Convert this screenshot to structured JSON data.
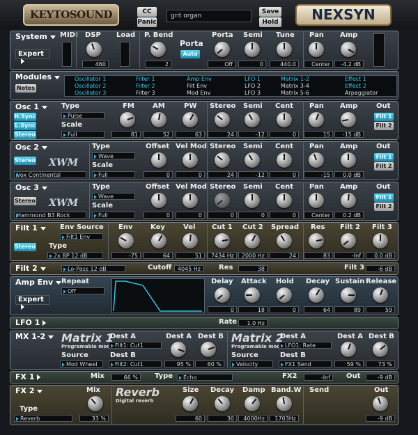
{
  "header": {
    "logo_left": "KEYTOSOUND",
    "logo_right": "NEXSYN",
    "cc": "CC",
    "panic": "Panic",
    "patch": "grit organ",
    "save": "Save",
    "hold": "Hold"
  },
  "system": {
    "title": "System",
    "expert": "Expert",
    "midi": "MIDI",
    "dsp": "DSP",
    "load": "Load",
    "pbend": "P. Bend",
    "porta_title": "Porta",
    "auto": "Auto",
    "porta": "Porta",
    "semi": "Semi",
    "tune": "Tune",
    "pan": "Pan",
    "amp": "Amp",
    "v_dsp": "460",
    "v_pbend": "2",
    "v_porta": "Off",
    "v_semi": "0",
    "v_tune": "440.0",
    "v_pan": "Center",
    "v_amp": "-4.2 dB"
  },
  "modules": {
    "title": "Modules",
    "notes": "Notes",
    "c1": [
      "Oscillator 1",
      "Oscillator 2",
      "Oscillator 3"
    ],
    "c2": [
      "Filter 1",
      "Filter 2",
      "Filter 3"
    ],
    "c3": [
      "Amp Env",
      "Filt Env",
      "Mod Env"
    ],
    "c4": [
      "LFO 1",
      "LFO 2",
      "LFO 3"
    ],
    "c5": [
      "Matrix 1-2",
      "Matrix 3-4",
      "Matrix 5-6"
    ],
    "c6": [
      "Effect 1",
      "Effect 2",
      "Arpeggiator"
    ]
  },
  "osc1": {
    "title": "Osc 1",
    "hsync": "H.Sync",
    "lsync": "L.Sync",
    "stereo": "Stereo",
    "type": "Type",
    "type_val": "Pulse",
    "scale": "Scale",
    "scale_val": "Full",
    "fm": "FM",
    "am": "AM",
    "pw": "PW",
    "st": "Stereo",
    "semi": "Semi",
    "cent": "Cent",
    "pan": "Pan",
    "amp": "Amp",
    "out": "Out",
    "f1": "Filt 1",
    "f2": "Filt 2",
    "v_fm": "81",
    "v_am": "52",
    "v_pw": "63",
    "v_st": "24",
    "v_semi": "-12",
    "v_cent": "0",
    "v_pan": "15",
    "v_amp": "-15 dB"
  },
  "osc2": {
    "title": "Osc 2",
    "stereo": "Stereo",
    "xwm": "XWM",
    "patch": "Vox Continental",
    "type": "Type",
    "type_val": "Wave",
    "scale": "Scale",
    "scale_val": "Full",
    "offset": "Offset",
    "velmod": "Vel Mod",
    "st": "Stereo",
    "semi": "Semi",
    "cent": "Cent",
    "pan": "Pan",
    "amp": "Amp",
    "out": "Out",
    "f1": "Filt 1",
    "f2": "Filt 2",
    "v_offset": "0",
    "v_velmod": "0",
    "v_st": "24",
    "v_semi": "-12",
    "v_cent": "0",
    "v_pan": "-15",
    "v_amp": "0.0 dB"
  },
  "osc3": {
    "title": "Osc 3",
    "stereo": "Stereo",
    "xwm": "XWM",
    "patch": "Hammond B3 Rock",
    "type": "Type",
    "type_val": "Wave",
    "scale": "Scale",
    "scale_val": "Full",
    "offset": "Offset",
    "velmod": "Vel Mod",
    "st": "Stereo",
    "semi": "Semi",
    "cent": "Cent",
    "pan": "Pan",
    "amp": "Amp",
    "out": "Out",
    "f1": "Filt 1",
    "f2": "Filt 2",
    "v_offset": "0",
    "v_velmod": "0",
    "v_st": "0",
    "v_semi": "0",
    "v_cent": "0",
    "v_pan": "Center",
    "v_amp": "0.2 dB"
  },
  "filt1": {
    "title": "Filt 1",
    "stereo": "Stereo",
    "envsrc": "Env Source",
    "envsrc_val": "Filt1 Env",
    "type": "Type",
    "type_val": "2x BP 12 dB",
    "env": "Env",
    "key": "Key",
    "vel": "Vel",
    "cut1": "Cut 1",
    "cut2": "Cut 2",
    "spread": "Spread",
    "res": "Res",
    "filt2": "Filt 2",
    "filt3": "Filt 3",
    "v_env": "-75",
    "v_key": "64",
    "v_vel": "51",
    "v_cut1": "7434 Hz",
    "v_cut2": "2000 Hz",
    "v_spread": "24",
    "v_res": "83",
    "v_filt2": "-Inf",
    "v_filt3": "0.0 dB"
  },
  "filt2": {
    "title": "Filt 2",
    "type_val": "Lo-Pass 12 dB",
    "cutoff": "Cutoff",
    "v_cutoff": "4045 Hz",
    "res": "Res",
    "v_res": "38",
    "filt3": "Filt 3",
    "v_filt3": "-6 dB"
  },
  "ampenv": {
    "title": "Amp Env",
    "repeat": "Repeat",
    "repeat_val": "Off",
    "expert": "Expert",
    "delay": "Delay",
    "attack": "Attack",
    "hold": "Hold",
    "decay": "Decay",
    "sustain": "Sustain",
    "release": "Release",
    "v_delay": "0",
    "v_attack": "18",
    "v_hold": "0",
    "v_decay": "64",
    "v_sustain": "89",
    "v_release": "59"
  },
  "lfo1": {
    "title": "LFO 1",
    "rate": "Rate",
    "v_rate": "1.0 Hz"
  },
  "mx": {
    "title": "MX 1-2",
    "m1": "Matrix 1",
    "m2": "Matrix 2",
    "sub": "Programable mod.",
    "source": "Source",
    "desta": "Dest A",
    "destb": "Dest B",
    "m1_source": "Mod Wheel",
    "m1_desta": "Filt1: Cut1",
    "m1_destb": "Filt2: Cut1",
    "m1_a": "95 %",
    "m1_b": "60 %",
    "m2_source": "Velocity",
    "m2_desta": "LFO1: Rate",
    "m2_destb": "FX1 Send",
    "m2_a": "59 %",
    "m2_b": "73 %"
  },
  "fx1": {
    "title": "FX 1",
    "mix": "Mix",
    "v_mix": "66 %",
    "type": "Type",
    "type_val": "Echo",
    "fx2": "FX2",
    "v_fx2": "-Inf",
    "out": "Out",
    "v_out": "-9 dB"
  },
  "fx2": {
    "title": "FX 2",
    "mix": "Mix",
    "type": "Type",
    "type_val": "Reverb",
    "reverb": "Reverb",
    "sub": "Digital reverb",
    "size": "Size",
    "decay": "Decay",
    "damp": "Damp",
    "bandw": "Band.W",
    "send": "Send",
    "out": "Out",
    "v_mix": "33 %",
    "v_size": "60",
    "v_decay": "30",
    "v_damp": "4000Hz",
    "v_bandw": "1703Hz",
    "v_out": "-9 dB"
  }
}
